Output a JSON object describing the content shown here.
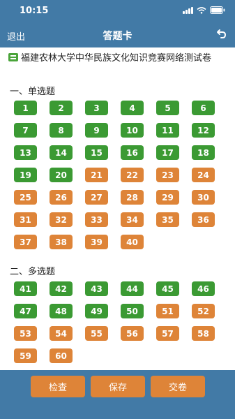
{
  "status_bar": {
    "time": "10:15"
  },
  "nav": {
    "back_label": "退出",
    "title": "答题卡"
  },
  "exam": {
    "title": "福建农林大学中华民族文化知识竞赛网络测试卷"
  },
  "sections": [
    {
      "title": "一、单选题",
      "start": 1,
      "count": 40,
      "answered_through": 20
    },
    {
      "title": "二、多选题",
      "start": 41,
      "count": 20,
      "answered_through": 50
    }
  ],
  "questions_single": [
    {
      "n": "1",
      "answered": true
    },
    {
      "n": "2",
      "answered": true
    },
    {
      "n": "3",
      "answered": true
    },
    {
      "n": "4",
      "answered": true
    },
    {
      "n": "5",
      "answered": true
    },
    {
      "n": "6",
      "answered": true
    },
    {
      "n": "7",
      "answered": true
    },
    {
      "n": "8",
      "answered": true
    },
    {
      "n": "9",
      "answered": true
    },
    {
      "n": "10",
      "answered": true
    },
    {
      "n": "11",
      "answered": true
    },
    {
      "n": "12",
      "answered": true
    },
    {
      "n": "13",
      "answered": true
    },
    {
      "n": "14",
      "answered": true
    },
    {
      "n": "15",
      "answered": true
    },
    {
      "n": "16",
      "answered": true
    },
    {
      "n": "17",
      "answered": true
    },
    {
      "n": "18",
      "answered": true
    },
    {
      "n": "19",
      "answered": true
    },
    {
      "n": "20",
      "answered": true
    },
    {
      "n": "21",
      "answered": false
    },
    {
      "n": "22",
      "answered": false
    },
    {
      "n": "23",
      "answered": false
    },
    {
      "n": "24",
      "answered": false
    },
    {
      "n": "25",
      "answered": false
    },
    {
      "n": "26",
      "answered": false
    },
    {
      "n": "27",
      "answered": false
    },
    {
      "n": "28",
      "answered": false
    },
    {
      "n": "29",
      "answered": false
    },
    {
      "n": "30",
      "answered": false
    },
    {
      "n": "31",
      "answered": false
    },
    {
      "n": "32",
      "answered": false
    },
    {
      "n": "33",
      "answered": false
    },
    {
      "n": "34",
      "answered": false
    },
    {
      "n": "35",
      "answered": false
    },
    {
      "n": "36",
      "answered": false
    },
    {
      "n": "37",
      "answered": false
    },
    {
      "n": "38",
      "answered": false
    },
    {
      "n": "39",
      "answered": false
    },
    {
      "n": "40",
      "answered": false
    }
  ],
  "questions_multi": [
    {
      "n": "41",
      "answered": true
    },
    {
      "n": "42",
      "answered": true
    },
    {
      "n": "43",
      "answered": true
    },
    {
      "n": "44",
      "answered": true
    },
    {
      "n": "45",
      "answered": true
    },
    {
      "n": "46",
      "answered": true
    },
    {
      "n": "47",
      "answered": true
    },
    {
      "n": "48",
      "answered": true
    },
    {
      "n": "49",
      "answered": true
    },
    {
      "n": "50",
      "answered": true
    },
    {
      "n": "51",
      "answered": false
    },
    {
      "n": "52",
      "answered": false
    },
    {
      "n": "53",
      "answered": false
    },
    {
      "n": "54",
      "answered": false
    },
    {
      "n": "55",
      "answered": false
    },
    {
      "n": "56",
      "answered": false
    },
    {
      "n": "57",
      "answered": false
    },
    {
      "n": "58",
      "answered": false
    },
    {
      "n": "59",
      "answered": false
    },
    {
      "n": "60",
      "answered": false
    }
  ],
  "actions": {
    "check_label": "检查",
    "save_label": "保存",
    "submit_label": "交卷"
  },
  "colors": {
    "header": "#427aa6",
    "answered": "#3b9a33",
    "unanswered": "#de8438",
    "action": "#de8438"
  },
  "icons": {
    "exam": "document-icon",
    "undo": "undo-icon",
    "signal": "signal-icon",
    "wifi": "wifi-icon",
    "battery": "battery-icon"
  }
}
